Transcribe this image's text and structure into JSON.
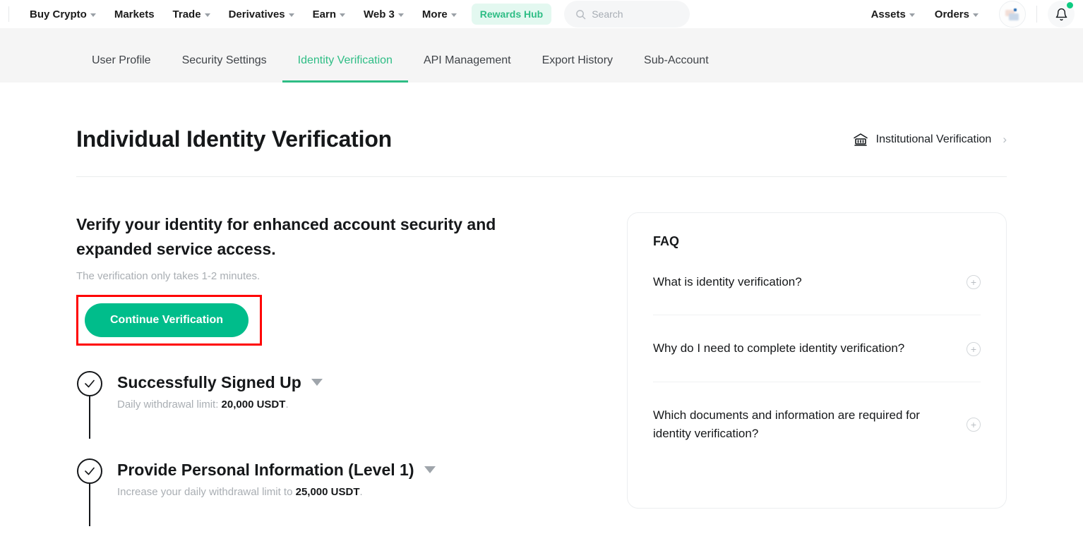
{
  "topnav": {
    "items": [
      {
        "label": "Buy Crypto",
        "has_caret": true
      },
      {
        "label": "Markets",
        "has_caret": false
      },
      {
        "label": "Trade",
        "has_caret": true
      },
      {
        "label": "Derivatives",
        "has_caret": true
      },
      {
        "label": "Earn",
        "has_caret": true
      },
      {
        "label": "Web 3",
        "has_caret": true
      },
      {
        "label": "More",
        "has_caret": true
      }
    ],
    "rewards_badge": "Rewards Hub",
    "search_placeholder": "Search",
    "right_items": [
      {
        "label": "Assets",
        "has_caret": true
      },
      {
        "label": "Orders",
        "has_caret": true
      }
    ],
    "accent_green": "#2ebd85",
    "badge_bg": "#e3f8f0",
    "notification_dot_color": "#0ecb81"
  },
  "tabs": [
    {
      "label": "User Profile",
      "active": false
    },
    {
      "label": "Security Settings",
      "active": false
    },
    {
      "label": "Identity Verification",
      "active": true
    },
    {
      "label": "API Management",
      "active": false
    },
    {
      "label": "Export History",
      "active": false
    },
    {
      "label": "Sub-Account",
      "active": false
    }
  ],
  "header": {
    "page_title": "Individual Identity Verification",
    "institutional_link": "Institutional Verification",
    "chevron": "›"
  },
  "main": {
    "lead": "Verify your identity for enhanced account security and expanded service access.",
    "sub": "The verification only takes 1-2 minutes.",
    "cta_label": "Continue Verification",
    "cta_color": "#00bd8b",
    "highlight_color": "#ff0000"
  },
  "steps": [
    {
      "title": "Successfully Signed Up",
      "desc_prefix": "Daily withdrawal limit: ",
      "desc_value": "20,000 USDT",
      "desc_suffix": ".",
      "completed": true
    },
    {
      "title": "Provide Personal Information (Level 1)",
      "desc_prefix": "Increase your daily withdrawal limit to ",
      "desc_value": "25,000 USDT",
      "desc_suffix": ".",
      "completed": true
    }
  ],
  "faq": {
    "title": "FAQ",
    "items": [
      {
        "question": "What is identity verification?"
      },
      {
        "question": "Why do I need to complete identity verification?"
      },
      {
        "question": "Which documents and information are required for identity verification?"
      }
    ],
    "expand_glyph": "+"
  }
}
